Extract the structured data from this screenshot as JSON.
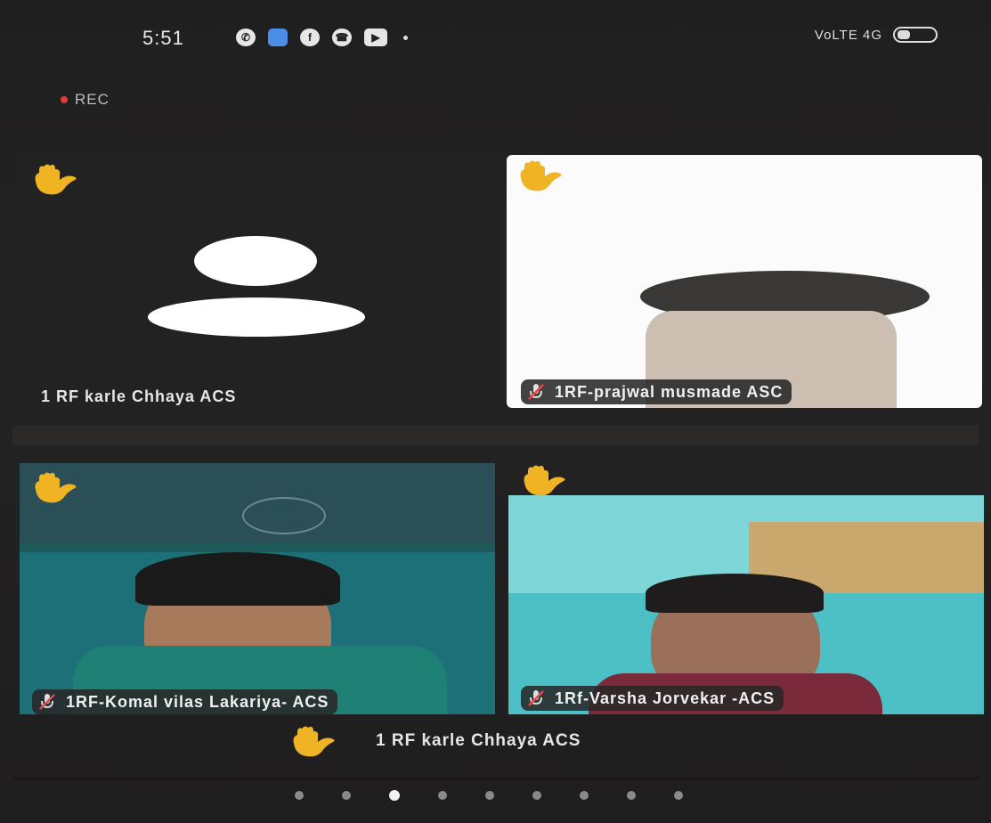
{
  "status_bar": {
    "time": "5:51",
    "network": "VoLTE 4G",
    "app_icons": [
      "whatsapp-icon",
      "messages-icon",
      "facebook-icon",
      "phone-icon",
      "youtube-icon"
    ]
  },
  "recording": {
    "label": "REC",
    "color": "#e23b3b"
  },
  "participants": [
    {
      "name": "1 RF  karle Chhaya ACS",
      "hand_raised": true,
      "video": false
    },
    {
      "name": "1RF-prajwal musmade ASC",
      "hand_raised": true,
      "video": true,
      "muted": true
    },
    {
      "name": "1RF-Komal vilas Lakariya- ACS",
      "hand_raised": true,
      "video": true,
      "muted": true
    },
    {
      "name": "1Rf-Varsha Jorvekar -ACS",
      "hand_raised": true,
      "video": true,
      "muted": true
    }
  ],
  "raised_hand_notice": {
    "name": "1 RF  karle Chhaya ACS"
  },
  "pagination": {
    "total": 9,
    "current": 3
  },
  "colors": {
    "hand": "#f0b323",
    "background": "#232222"
  }
}
